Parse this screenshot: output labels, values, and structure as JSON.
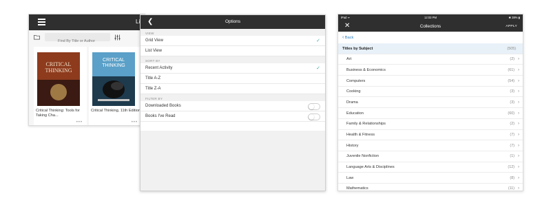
{
  "library": {
    "title": "Lib",
    "search_placeholder": "Find By Title or Author",
    "books": [
      {
        "title": "Critical Thinking: Tools for Taking Cha...",
        "cover_text": "CRITICAL THINKING",
        "more": "•••"
      },
      {
        "title": "Critical Thinking, 11th Edition",
        "cover_text": "CRITICAL THINKING",
        "more": "•••"
      }
    ]
  },
  "options": {
    "title": "Options",
    "back_icon": "chevron-left-icon",
    "sections": [
      {
        "label": "VIEW",
        "items": [
          {
            "label": "Grid View",
            "checked": true
          },
          {
            "label": "List View",
            "checked": false
          }
        ]
      },
      {
        "label": "SORT BY",
        "items": [
          {
            "label": "Recent Activity",
            "checked": true
          },
          {
            "label": "Title A-Z",
            "checked": false
          },
          {
            "label": "Title Z-A",
            "checked": false
          }
        ]
      },
      {
        "label": "FILTER BY",
        "items": [
          {
            "label": "Downloaded Books",
            "toggle": false
          },
          {
            "label": "Books I've Read",
            "toggle": false
          }
        ]
      }
    ],
    "check_glyph": "✓",
    "accent_color": "#3aa7a0"
  },
  "collections": {
    "status": {
      "left": "iPad ᯤ",
      "time": "12:03 PM",
      "right": "✱ 38% ▮"
    },
    "title": "Collections",
    "apply_label": "APPLY",
    "close_glyph": "✕",
    "back_label": "Back",
    "subject": {
      "label": "Titles by Subject",
      "count": "(505)"
    },
    "items": [
      {
        "label": "Art",
        "count": "(2)"
      },
      {
        "label": "Business & Economics",
        "count": "(61)"
      },
      {
        "label": "Computers",
        "count": "(54)"
      },
      {
        "label": "Cooking",
        "count": "(3)"
      },
      {
        "label": "Drama",
        "count": "(3)"
      },
      {
        "label": "Education",
        "count": "(60)"
      },
      {
        "label": "Family & Relationships",
        "count": "(2)"
      },
      {
        "label": "Health & Fitness",
        "count": "(7)"
      },
      {
        "label": "History",
        "count": "(7)"
      },
      {
        "label": "Juvenile Nonfiction",
        "count": "(1)"
      },
      {
        "label": "Language Arts & Disciplines",
        "count": "(12)"
      },
      {
        "label": "Law",
        "count": "(8)"
      },
      {
        "label": "Mathematics",
        "count": "(11)"
      }
    ],
    "link_color": "#2d7fc1"
  }
}
